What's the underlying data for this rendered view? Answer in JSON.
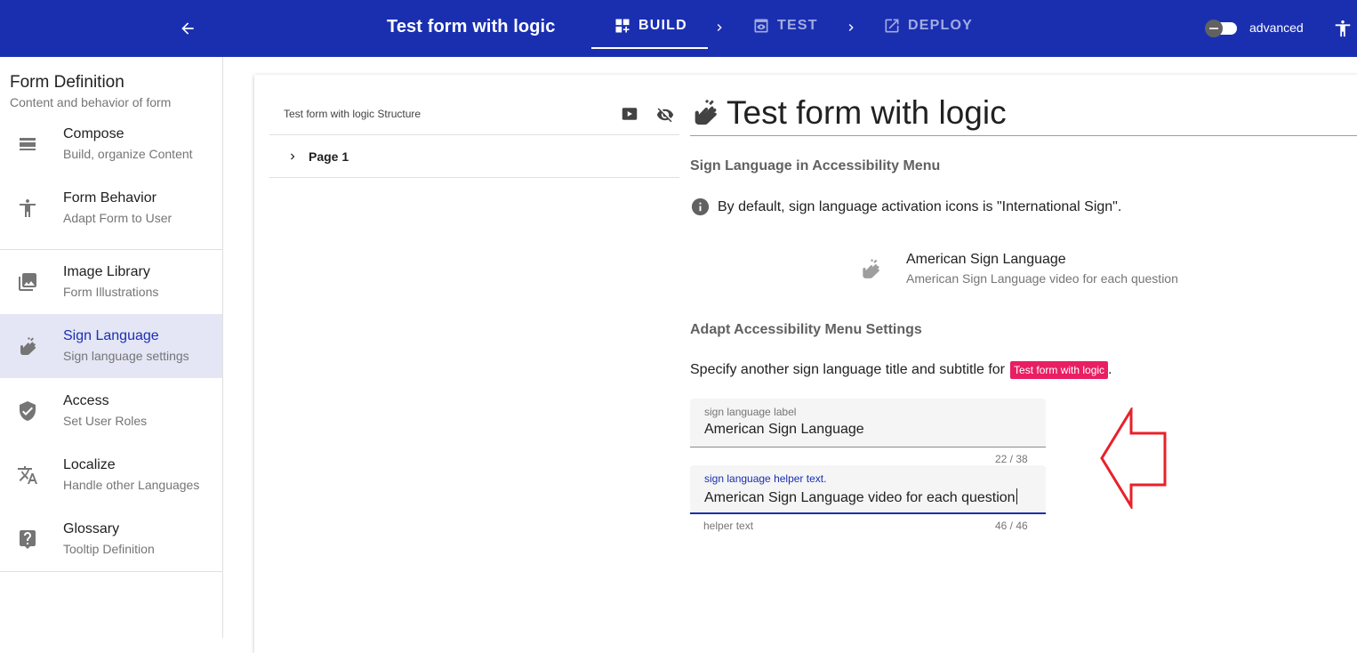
{
  "header": {
    "title": "Test form with logic",
    "steps": [
      {
        "label": "BUILD",
        "icon": "build-dashboard-icon",
        "active": true
      },
      {
        "label": "TEST",
        "icon": "preview-eye-icon",
        "active": false
      },
      {
        "label": "DEPLOY",
        "icon": "open-in-new-icon",
        "active": false
      }
    ],
    "advanced_label": "advanced",
    "advanced_enabled": false
  },
  "sidebar": {
    "title": "Form Definition",
    "subtitle": "Content and behavior of form",
    "items": [
      {
        "label": "Compose",
        "sub": "Build, organize Content",
        "icon": "view-stream-icon"
      },
      {
        "label": "Form Behavior",
        "sub": "Adapt Form to User",
        "icon": "accessibility-icon"
      },
      {
        "label": "Image Library",
        "sub": "Form Illustrations",
        "icon": "photo-library-icon"
      },
      {
        "label": "Sign Language",
        "sub": "Sign language settings",
        "icon": "sign-language-icon",
        "active": true
      },
      {
        "label": "Access",
        "sub": "Set User Roles",
        "icon": "verified-shield-icon"
      },
      {
        "label": "Localize",
        "sub": "Handle other Languages",
        "icon": "translate-icon"
      },
      {
        "label": "Glossary",
        "sub": "Tooltip Definition",
        "icon": "help-box-icon"
      }
    ]
  },
  "structure": {
    "heading": "Test form with logic Structure",
    "pages": [
      {
        "label": "Page 1"
      }
    ]
  },
  "editor": {
    "title": "Test form with logic",
    "section1_heading": "Sign Language in Accessibility Menu",
    "info_text": "By default, sign language activation icons is \"International Sign\".",
    "preview": {
      "title": "American Sign Language",
      "subtitle": "American Sign Language video for each question"
    },
    "section2_heading": "Adapt Accessibility Menu Settings",
    "specify_text": "Specify another sign language title and subtitle for",
    "specify_chip": "Test form with logic",
    "specify_suffix": ".",
    "label_field": {
      "label": "sign language label",
      "value": "American Sign Language",
      "counter": "22 / 38"
    },
    "helper_field": {
      "label": "sign language helper text.",
      "value": "American Sign Language video for each question",
      "helper": "helper text",
      "counter": "46 / 46"
    }
  },
  "colors": {
    "primary": "#1a2fb0",
    "chip": "#e91e63",
    "annotation_arrow": "#e8212a",
    "active_item_bg": "#e4e6f6"
  }
}
